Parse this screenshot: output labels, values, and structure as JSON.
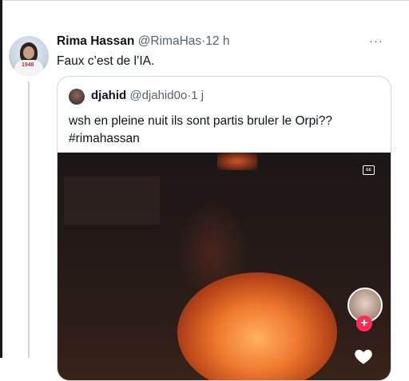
{
  "tweet": {
    "author_name": "Rima Hassan",
    "handle": "@RimaHas",
    "dot": "·",
    "time": "12 h",
    "more_icon": "more-icon",
    "text": "Faux c’est de l’IA.",
    "avatar_badge": "1948"
  },
  "quote": {
    "author_name": "djahid",
    "handle": "@djahid0o",
    "dot": "·",
    "time": "1 j",
    "text": "wsh en pleine nuit ils sont partis bruler le Orpi?? #rimahassan"
  },
  "video": {
    "cc_label": "cc",
    "follow_plus": "+",
    "icons": [
      "closed-captions-icon",
      "profile-avatar",
      "follow-plus-icon",
      "like-heart-icon"
    ]
  },
  "colors": {
    "text": "#0f1419",
    "secondary": "#536471",
    "border": "#cfd9de",
    "tiktok_red": "#fe2c55"
  }
}
